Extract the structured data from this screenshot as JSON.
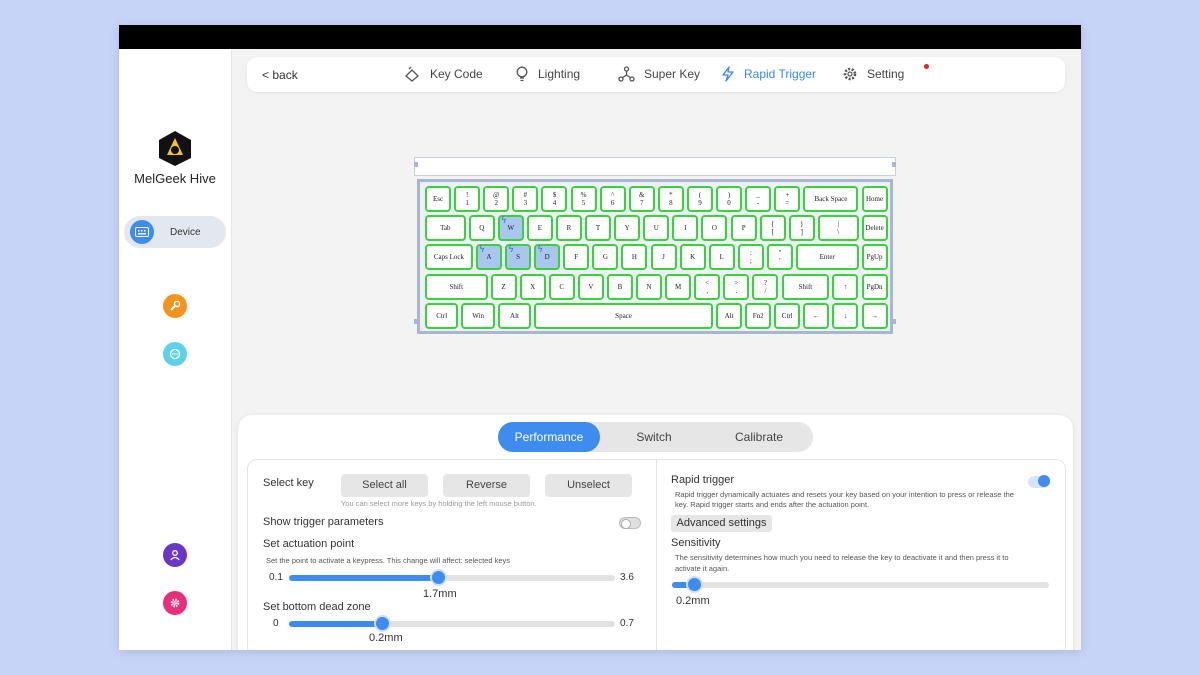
{
  "app": {
    "brand": "MelGeek Hive"
  },
  "sidebar": {
    "device_label": "Device"
  },
  "nav": {
    "back": "< back",
    "tabs": [
      {
        "label": "Key Code",
        "icon": "keycap-icon"
      },
      {
        "label": "Lighting",
        "icon": "lightbulb-icon"
      },
      {
        "label": "Super Key",
        "icon": "nodes-icon"
      },
      {
        "label": "Rapid Trigger",
        "icon": "bolt-icon",
        "active": true
      },
      {
        "label": "Setting",
        "icon": "gear-icon"
      }
    ]
  },
  "keyboard": {
    "rows": [
      [
        {
          "t": "Esc"
        },
        {
          "t": "!\n1"
        },
        {
          "t": "@\n2"
        },
        {
          "t": "#\n3"
        },
        {
          "t": "$\n4"
        },
        {
          "t": "%\n5"
        },
        {
          "t": "^\n6"
        },
        {
          "t": "&\n7"
        },
        {
          "t": "*\n8"
        },
        {
          "t": "(\n9"
        },
        {
          "t": ")\n0"
        },
        {
          "t": "_\n-"
        },
        {
          "t": "+\n="
        },
        {
          "t": "Back Space",
          "w": 2
        },
        {
          "t": "Home"
        }
      ],
      [
        {
          "t": "Tab",
          "w": 1.5
        },
        {
          "t": "Q"
        },
        {
          "t": "W",
          "sel": true
        },
        {
          "t": "E"
        },
        {
          "t": "R"
        },
        {
          "t": "T"
        },
        {
          "t": "Y"
        },
        {
          "t": "U"
        },
        {
          "t": "I"
        },
        {
          "t": "O"
        },
        {
          "t": "P"
        },
        {
          "t": "{\n["
        },
        {
          "t": "}\n]"
        },
        {
          "t": "|\n\\",
          "w": 1.5
        },
        {
          "t": "Delete"
        }
      ],
      [
        {
          "t": "Caps Lock",
          "w": 1.75
        },
        {
          "t": "A",
          "sel": true
        },
        {
          "t": "S",
          "sel": true
        },
        {
          "t": "D",
          "sel": true
        },
        {
          "t": "F"
        },
        {
          "t": "G"
        },
        {
          "t": "H"
        },
        {
          "t": "J"
        },
        {
          "t": "K"
        },
        {
          "t": "L"
        },
        {
          "t": ":\n;"
        },
        {
          "t": "\"\n'"
        },
        {
          "t": "Enter",
          "w": 2.25
        },
        {
          "t": "PgUp"
        }
      ],
      [
        {
          "t": "Shift",
          "w": 2.25
        },
        {
          "t": "Z"
        },
        {
          "t": "X"
        },
        {
          "t": "C"
        },
        {
          "t": "V"
        },
        {
          "t": "B"
        },
        {
          "t": "N"
        },
        {
          "t": "M"
        },
        {
          "t": "<\n,"
        },
        {
          "t": ">\n."
        },
        {
          "t": "?\n/"
        },
        {
          "t": "Shift",
          "w": 1.75
        },
        {
          "t": "↑"
        },
        {
          "t": "PgDn"
        }
      ],
      [
        {
          "t": "Ctrl",
          "w": 1.25
        },
        {
          "t": "Win",
          "w": 1.25
        },
        {
          "t": "Alt",
          "w": 1.25
        },
        {
          "t": "Space",
          "w": 6.25
        },
        {
          "t": "Alt"
        },
        {
          "t": "Fn2"
        },
        {
          "t": "Ctrl"
        },
        {
          "t": "←"
        },
        {
          "t": "↓"
        },
        {
          "t": "→"
        }
      ]
    ]
  },
  "panel": {
    "tabs": [
      {
        "label": "Performance",
        "active": true
      },
      {
        "label": "Switch"
      },
      {
        "label": "Calibrate"
      }
    ],
    "left": {
      "select_key_label": "Select key",
      "buttons": [
        "Select all",
        "Reverse",
        "Unselect"
      ],
      "hint": "You can select more keys by holding the left mouse button.",
      "show_trigger_label": "Show trigger parameters",
      "show_trigger_on": false,
      "actuation": {
        "title": "Set actuation point",
        "desc": "Set the point to activate a keypress. This change will affect: selected keys",
        "min": "0.1",
        "max": "3.6",
        "value": 1.7,
        "value_label": "1.7mm"
      },
      "dead_zone": {
        "title": "Set bottom dead zone",
        "min": "0",
        "max": "0.7",
        "value": 0.2,
        "value_label": "0.2mm"
      }
    },
    "right": {
      "rapid_trigger_label": "Rapid trigger",
      "rapid_trigger_on": true,
      "rapid_trigger_desc_1": "Rapid trigger dynamically actuates and resets your key based on your intention to press or release the",
      "rapid_trigger_desc_2": "key. Rapid trigger starts and ends after the actuation point.",
      "advanced_label": "Advanced settings",
      "sensitivity_label": "Sensitivity",
      "sensitivity_desc_1": "The sensitivity determines how much you need to release the key to deactivate it and then press it to",
      "sensitivity_desc_2": "activate it again.",
      "sensitivity_value": 0.2,
      "sensitivity_max": 3.4,
      "sensitivity_value_label": "0.2mm"
    }
  },
  "colors": {
    "accent": "#3f8cf0",
    "key_outline": "#3ad23a",
    "selected_key": "#a9c6ef",
    "red_dot": "#e22222"
  }
}
